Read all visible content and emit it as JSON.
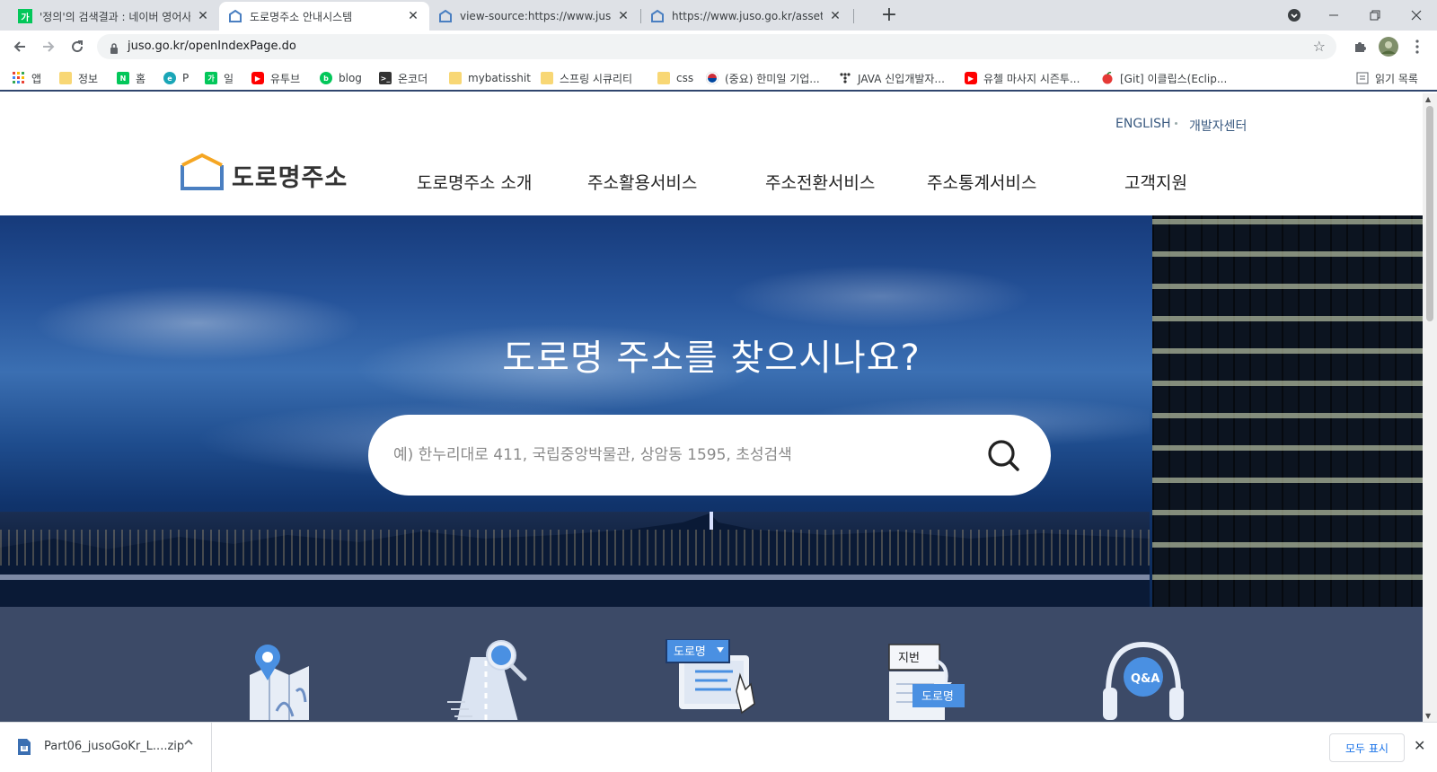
{
  "browser": {
    "tabs": [
      {
        "title": "'정의'의 검색결과 : 네이버 영어사전",
        "favicon": "naver-dict-icon",
        "active": false
      },
      {
        "title": "도로명주소 안내시스템",
        "favicon": "juso-house-icon",
        "active": true
      },
      {
        "title": "view-source:https://www.juso.go.kr",
        "favicon": "juso-house-icon",
        "active": false
      },
      {
        "title": "https://www.juso.go.kr/assets/css",
        "favicon": "juso-house-icon",
        "active": false
      }
    ],
    "new_tab": "+",
    "address": "juso.go.kr/openIndexPage.do",
    "bookmarks": [
      {
        "label": "앱",
        "icon": "apps-grid-icon"
      },
      {
        "label": "정보",
        "icon": "folder-icon"
      },
      {
        "label": "홈",
        "icon": "naver-icon"
      },
      {
        "label": "P",
        "icon": "p-icon"
      },
      {
        "label": "일",
        "icon": "dict-icon"
      },
      {
        "label": "유투브",
        "icon": "youtube-icon"
      },
      {
        "label": "blog",
        "icon": "blog-icon"
      },
      {
        "label": "온코더",
        "icon": "terminal-icon"
      },
      {
        "label": "mybatisshit",
        "icon": "folder-icon"
      },
      {
        "label": "스프링 시큐리티",
        "icon": "folder-icon"
      },
      {
        "label": "css",
        "icon": "folder-icon"
      },
      {
        "label": "(중요) 한미일 기업...",
        "icon": "korea-flag-icon"
      },
      {
        "label": "JAVA 신입개발자...",
        "icon": "dots-icon"
      },
      {
        "label": "유첼 마사지 시즌투...",
        "icon": "youtube-icon"
      },
      {
        "label": "[Git] 이클립스(Eclip...",
        "icon": "apple-icon"
      }
    ],
    "reading_list": "읽기 목록"
  },
  "site": {
    "util_links": [
      "ENGLISH",
      "개발자센터"
    ],
    "logo_text": "도로명주소",
    "nav": [
      "도로명주소 소개",
      "주소활용서비스",
      "주소전환서비스",
      "주소통계서비스",
      "고객지원"
    ],
    "hero_title": "도로명 주소를 찾으시나요?",
    "search_placeholder": "예) 한누리대로 411, 국립중앙박물관, 상암동 1595, 초성검색",
    "quick_icons": {
      "road_badge": "도로명",
      "jibun_label": "지번",
      "doro_label": "도로명",
      "qa_label": "Q&A"
    }
  },
  "downloads": {
    "file_name": "Part06_jusoGoKr_L....zip",
    "show_all": "모두 표시"
  },
  "colors": {
    "tabstrip": "#dee1e6",
    "logo_orange": "#f5a623",
    "logo_blue": "#4a7fc1",
    "quick_bg": "#3c4a67",
    "nav_text": "#222222"
  }
}
